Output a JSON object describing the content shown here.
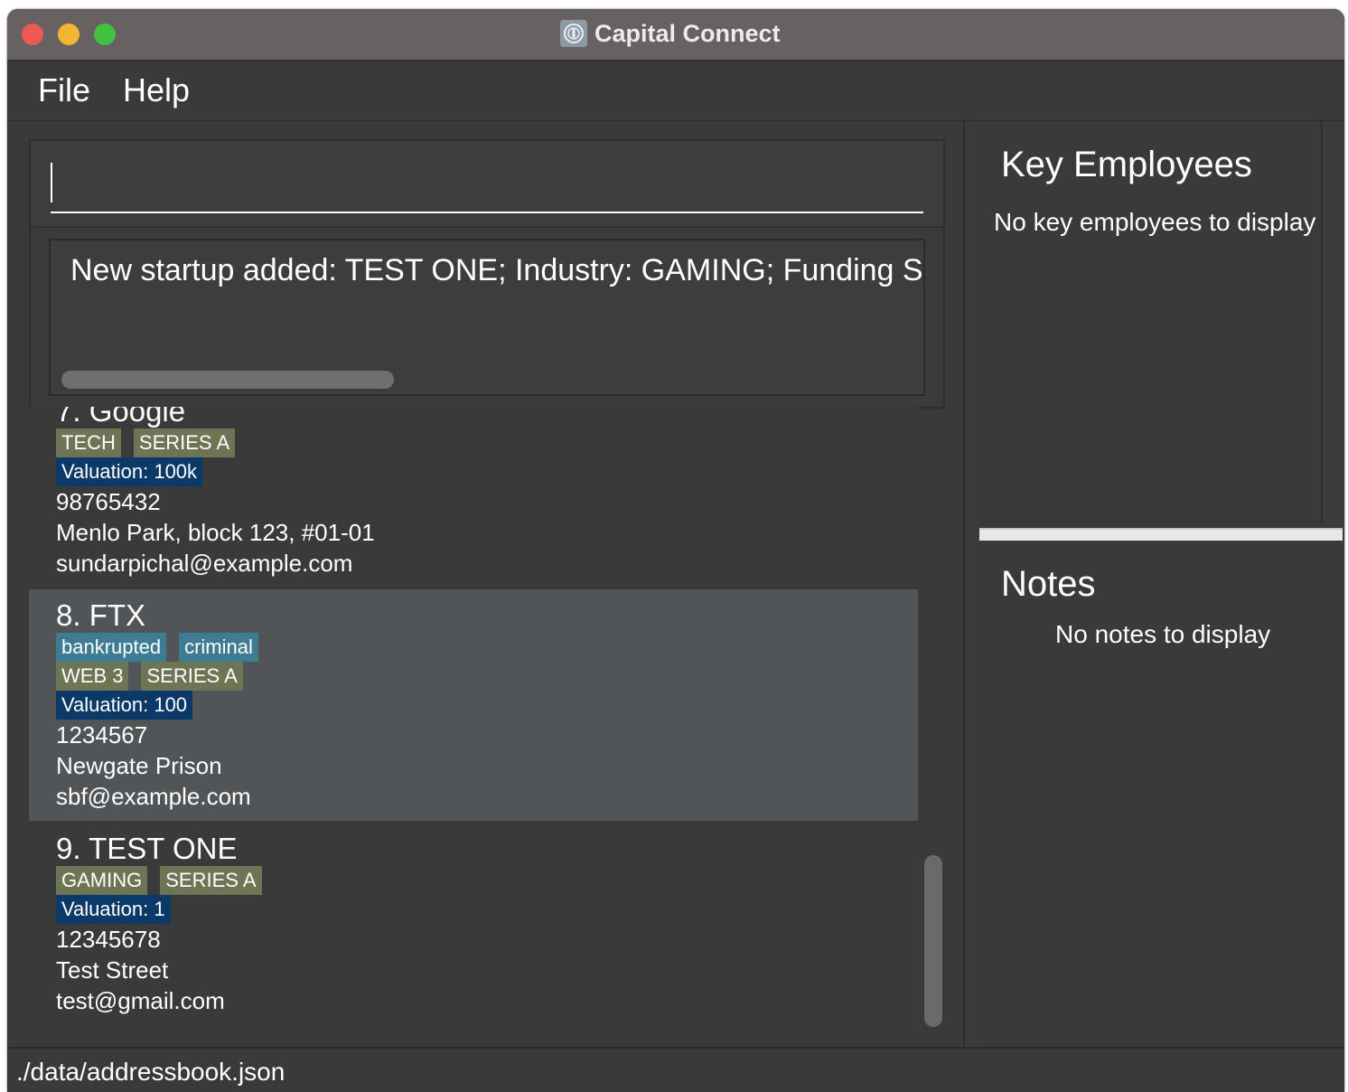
{
  "window": {
    "title": "Capital Connect"
  },
  "menu": {
    "items": [
      "File",
      "Help"
    ]
  },
  "command_box": {
    "value": "",
    "placeholder": ""
  },
  "result_display": {
    "text": "New startup added: TEST ONE; Industry: GAMING; Funding Stage"
  },
  "startups": [
    {
      "index": "7.",
      "name": "Google",
      "tags": [],
      "industry": "TECH",
      "funding_stage": "SERIES A",
      "valuation": "Valuation: 100k",
      "phone": "98765432",
      "address": "Menlo Park, block 123, #01-01",
      "email": "sundarpichal@example.com",
      "selected": false
    },
    {
      "index": "8.",
      "name": "FTX",
      "tags": [
        "bankrupted",
        "criminal"
      ],
      "industry": "WEB 3",
      "funding_stage": "SERIES A",
      "valuation": "Valuation: 100",
      "phone": "1234567",
      "address": "Newgate Prison",
      "email": "sbf@example.com",
      "selected": true
    },
    {
      "index": "9.",
      "name": "TEST ONE",
      "tags": [],
      "industry": "GAMING",
      "funding_stage": "SERIES A",
      "valuation": "Valuation: 1",
      "phone": "12345678",
      "address": "Test Street",
      "email": "test@gmail.com",
      "selected": false
    }
  ],
  "key_employees": {
    "title": "Key Employees",
    "empty_message": "No key employees to display"
  },
  "notes": {
    "title": "Notes",
    "empty_message": "No notes to display"
  },
  "status_bar": {
    "file_path": "./data/addressbook.json"
  },
  "colors": {
    "tag_industry": "#6e7555",
    "tag_valuation": "#0b3a68",
    "tag_custom": "#3d7c92",
    "selected_card": "#515558",
    "background": "#3a3a3a"
  }
}
